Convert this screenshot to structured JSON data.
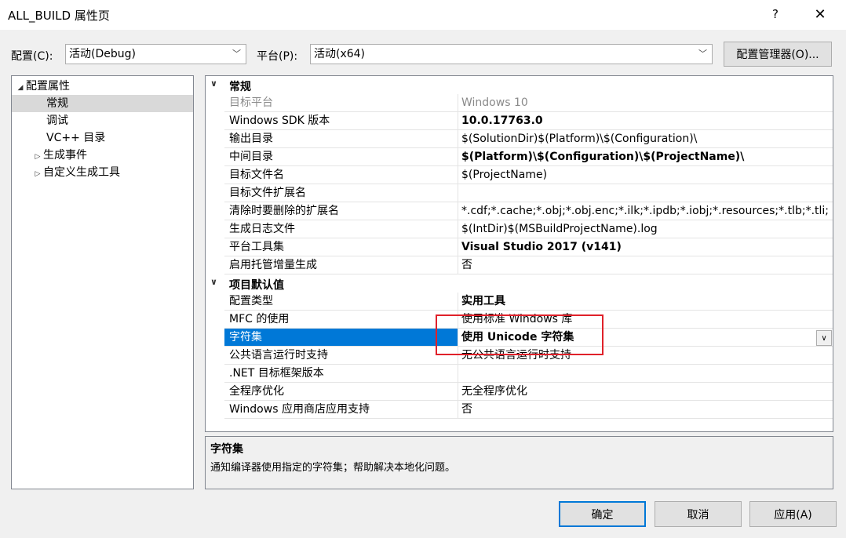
{
  "window": {
    "title": "ALL_BUILD 属性页",
    "help_label": "?",
    "close_label": "✕"
  },
  "toolbar": {
    "config_label": "配置(C):",
    "config_value": "活动(Debug)",
    "platform_label": "平台(P):",
    "platform_value": "活动(x64)",
    "config_manager_label": "配置管理器(O)..."
  },
  "tree": {
    "root_label": "配置属性",
    "items": [
      {
        "label": "常规"
      },
      {
        "label": "调试"
      },
      {
        "label": "VC++ 目录"
      },
      {
        "label": "生成事件"
      },
      {
        "label": "自定义生成工具"
      }
    ]
  },
  "grid": {
    "category1": "常规",
    "category2": "项目默认值",
    "general": [
      {
        "name": "目标平台",
        "value": "Windows 10"
      },
      {
        "name": "Windows SDK 版本",
        "value": "10.0.17763.0"
      },
      {
        "name": "输出目录",
        "value": "$(SolutionDir)$(Platform)\\$(Configuration)\\"
      },
      {
        "name": "中间目录",
        "value": "$(Platform)\\$(Configuration)\\$(ProjectName)\\"
      },
      {
        "name": "目标文件名",
        "value": "$(ProjectName)"
      },
      {
        "name": "目标文件扩展名",
        "value": ""
      },
      {
        "name": "清除时要删除的扩展名",
        "value": "*.cdf;*.cache;*.obj;*.obj.enc;*.ilk;*.ipdb;*.iobj;*.resources;*.tlb;*.tli;"
      },
      {
        "name": "生成日志文件",
        "value": "$(IntDir)$(MSBuildProjectName).log"
      },
      {
        "name": "平台工具集",
        "value": "Visual Studio 2017 (v141)"
      },
      {
        "name": "启用托管增量生成",
        "value": "否"
      }
    ],
    "defaults": [
      {
        "name": "配置类型",
        "value": "实用工具"
      },
      {
        "name": "MFC 的使用",
        "value": "使用标准 Windows 库"
      },
      {
        "name": "字符集",
        "value": "使用 Unicode 字符集"
      },
      {
        "name": "公共语言运行时支持",
        "value": "无公共语言运行时支持"
      },
      {
        "name": ".NET 目标框架版本",
        "value": ""
      },
      {
        "name": "全程序优化",
        "value": "无全程序优化"
      },
      {
        "name": "Windows 应用商店应用支持",
        "value": "否"
      }
    ]
  },
  "description": {
    "title": "字符集",
    "text": "通知编译器使用指定的字符集；帮助解决本地化问题。"
  },
  "buttons": {
    "ok": "确定",
    "cancel": "取消",
    "apply": "应用(A)"
  },
  "colors": {
    "selection": "#0078d7",
    "highlight_box": "#e0212a"
  }
}
